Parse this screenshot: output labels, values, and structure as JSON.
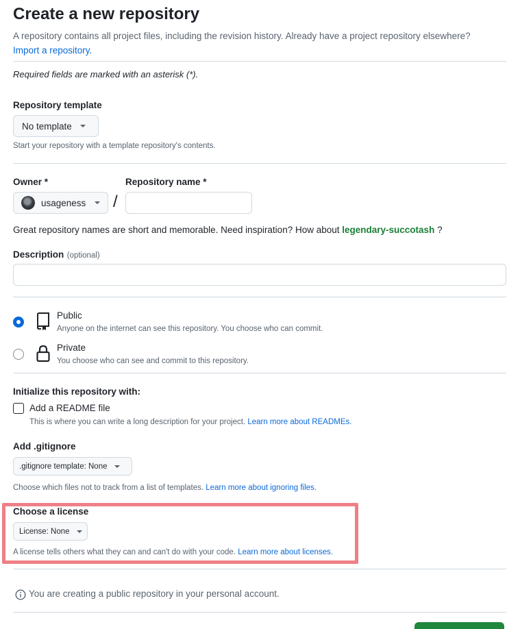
{
  "header": {
    "title": "Create a new repository",
    "description": "A repository contains all project files, including the revision history. Already have a project repository elsewhere?",
    "import_link": "Import a repository."
  },
  "required_note": "Required fields are marked with an asterisk (*).",
  "template": {
    "label": "Repository template",
    "button": "No template",
    "note": "Start your repository with a template repository's contents."
  },
  "owner": {
    "label": "Owner *",
    "value": "usageness",
    "separator": "/"
  },
  "repo_name": {
    "label": "Repository name *",
    "value": ""
  },
  "suggestion": {
    "text": "Great repository names are short and memorable. Need inspiration? How about",
    "name": "legendary-succotash",
    "suffix": "?"
  },
  "description": {
    "label": "Description",
    "optional": "(optional)",
    "value": ""
  },
  "visibility": {
    "options": [
      {
        "title": "Public",
        "desc": "Anyone on the internet can see this repository. You choose who can commit.",
        "checked": true
      },
      {
        "title": "Private",
        "desc": "You choose who can see and commit to this repository.",
        "checked": false
      }
    ]
  },
  "initialize": {
    "label": "Initialize this repository with:",
    "readme": {
      "title": "Add a README file",
      "desc": "This is where you can write a long description for your project.",
      "link": "Learn more about READMEs.",
      "checked": false
    }
  },
  "gitignore": {
    "label": "Add .gitignore",
    "button": ".gitignore template: None",
    "note": "Choose which files not to track from a list of templates.",
    "link": "Learn more about ignoring files."
  },
  "license": {
    "label": "Choose a license",
    "button": "License: None",
    "note": "A license tells others what they can and can't do with your code.",
    "link": "Learn more about licenses."
  },
  "info": {
    "text": "You are creating a public repository in your personal account."
  },
  "colors": {
    "accent": "#0969da",
    "green": "#1a7f37",
    "highlight": "#ef7f86"
  }
}
